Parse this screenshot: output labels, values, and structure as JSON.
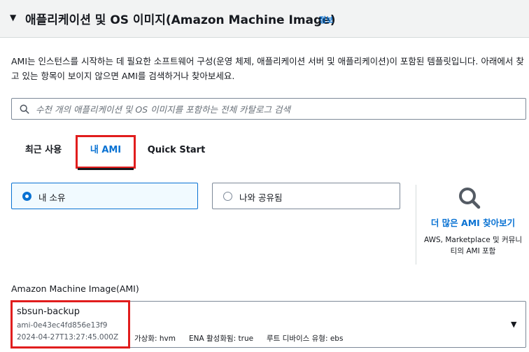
{
  "section": {
    "title": "애플리케이션 및 OS 이미지(Amazon Machine Image)",
    "info_link": "정보",
    "description": "AMI는 인스턴스를 시작하는 데 필요한 소프트웨어 구성(운영 체제, 애플리케이션 서버 및 애플리케이션)이 포함된 템플릿입니다. 아래에서 찾고 있는 항목이 보이지 않으면 AMI를 검색하거나 찾아보세요."
  },
  "search": {
    "placeholder": "수천 개의 애플리케이션 및 OS 이미지를 포함하는 전체 카탈로그 검색",
    "value": ""
  },
  "tabs": [
    {
      "label": "최근 사용",
      "active": false
    },
    {
      "label": "내 AMI",
      "active": true
    },
    {
      "label": "Quick Start",
      "active": false
    }
  ],
  "ownership": {
    "options": [
      {
        "label": "내 소유",
        "selected": true
      },
      {
        "label": "나와 공유됨",
        "selected": false
      }
    ]
  },
  "browse_more": {
    "link": "더 많은 AMI 찾아보기",
    "description": "AWS, Marketplace 및 커뮤니티의 AMI 포함"
  },
  "ami_select": {
    "label": "Amazon Machine Image(AMI)",
    "name": "sbsun-backup",
    "id": "ami-0e43ec4fd856e13f9",
    "date": "2024-04-27T13:27:45.000Z",
    "virtualization": "가상화: hvm",
    "ena": "ENA 활성화됨: true",
    "root_device": "루트 디바이스 유형: ebs"
  },
  "colors": {
    "accent": "#0972d3",
    "highlight_box": "#e11d1d",
    "header_bg": "#f2f3f3"
  }
}
